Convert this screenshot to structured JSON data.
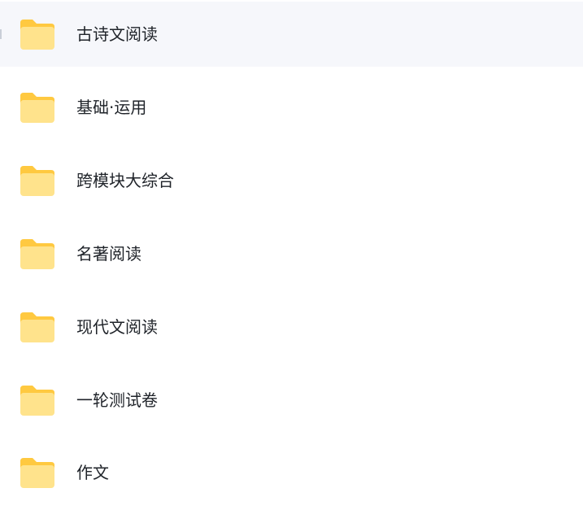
{
  "folders": {
    "items": [
      {
        "label": "古诗文阅读",
        "icon": "folder-icon",
        "hovered": true
      },
      {
        "label": "基础·运用",
        "icon": "folder-icon",
        "hovered": false
      },
      {
        "label": "跨模块大综合",
        "icon": "folder-icon",
        "hovered": false
      },
      {
        "label": "名著阅读",
        "icon": "folder-icon",
        "hovered": false
      },
      {
        "label": "现代文阅读",
        "icon": "folder-icon",
        "hovered": false
      },
      {
        "label": "一轮测试卷",
        "icon": "folder-icon",
        "hovered": false
      },
      {
        "label": "作文",
        "icon": "folder-icon",
        "hovered": false
      }
    ]
  },
  "colors": {
    "folder_back": "#ffc940",
    "folder_front": "#ffe38c",
    "hover_background": "#f6f7fb",
    "text": "#1f2329"
  }
}
